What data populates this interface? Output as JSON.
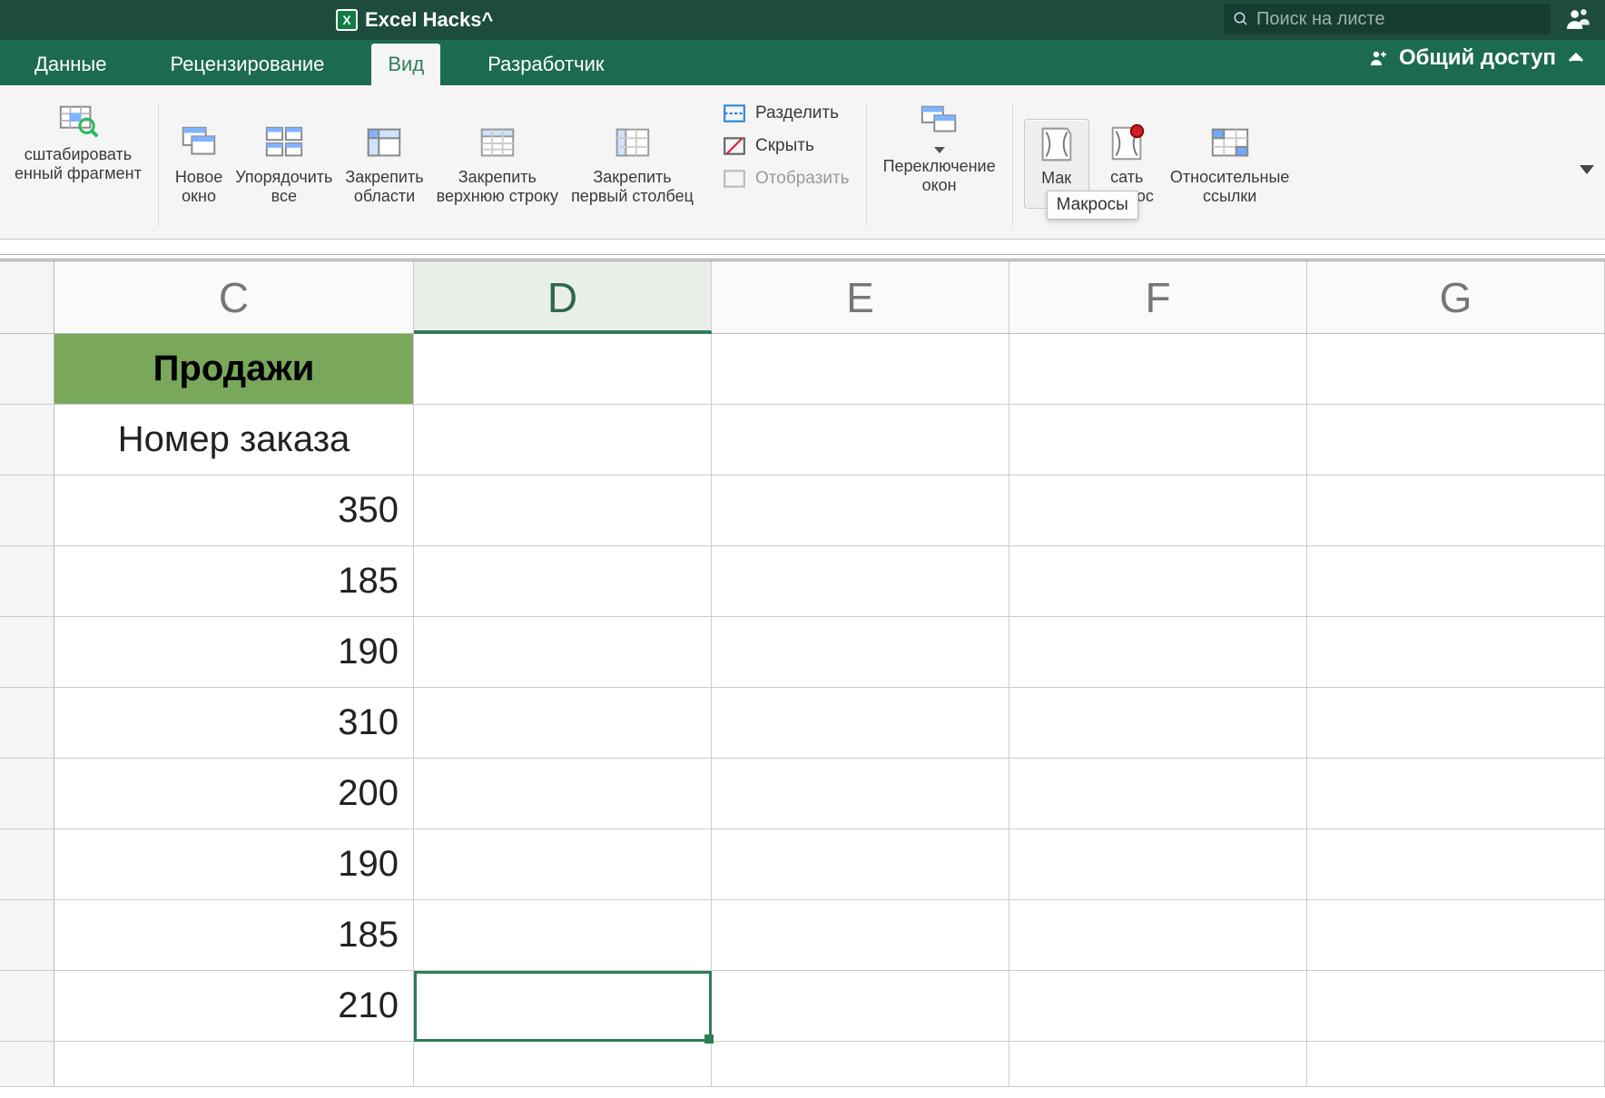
{
  "title": "Excel Hacks^",
  "search_placeholder": "Поиск на листе",
  "share_label": "Общий доступ",
  "tabs": {
    "data": "Данные",
    "review": "Рецензирование",
    "view": "Вид",
    "developer": "Разработчик"
  },
  "ribbon": {
    "zoom_sel": {
      "l1": "сштабировать",
      "l2": "енный фрагмент"
    },
    "new_window": {
      "l1": "Новое",
      "l2": "окно"
    },
    "arrange_all": {
      "l1": "Упорядочить",
      "l2": "все"
    },
    "freeze_panes": {
      "l1": "Закрепить",
      "l2": "области"
    },
    "freeze_top": {
      "l1": "Закрепить",
      "l2": "верхнюю строку"
    },
    "freeze_first": {
      "l1": "Закрепить",
      "l2": "первый столбец"
    },
    "split": "Разделить",
    "hide": "Скрыть",
    "unhide": "Отобразить",
    "switch_win": {
      "l1": "Переключение",
      "l2": "окон"
    },
    "macros": {
      "l1": "Мак",
      "l2": "сы"
    },
    "record_macro": {
      "l1": "сать",
      "l2": "макрос"
    },
    "rel_refs": {
      "l1": "Относительные",
      "l2": "ссылки"
    },
    "tooltip": "Макросы"
  },
  "columns": {
    "C": "C",
    "D": "D",
    "E": "E",
    "F": "F",
    "G": "G"
  },
  "sheet": {
    "r1": {
      "C": "Продажи"
    },
    "r2": {
      "C": "Номер заказа"
    },
    "r3": {
      "C": "350"
    },
    "r4": {
      "C": "185"
    },
    "r5": {
      "C": "190"
    },
    "r6": {
      "C": "310"
    },
    "r7": {
      "C": "200"
    },
    "r8": {
      "C": "190"
    },
    "r9": {
      "C": "185"
    },
    "r10": {
      "C": "210"
    }
  }
}
